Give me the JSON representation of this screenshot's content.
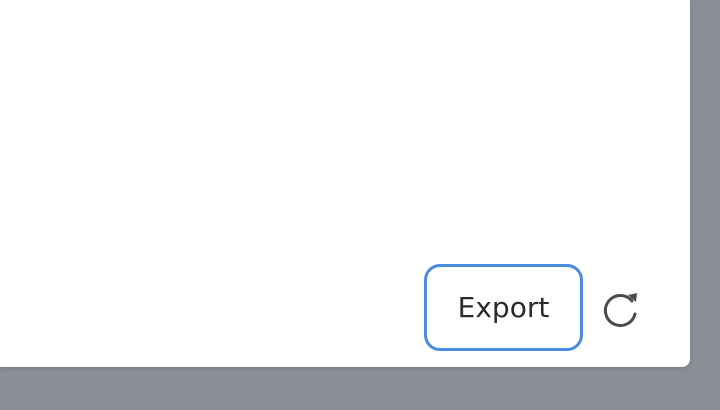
{
  "dialog": {
    "export_label": "Export",
    "refresh_icon": "refresh-icon"
  },
  "colors": {
    "backdrop": "#8b8d98",
    "panel": "#ffffff",
    "focus_ring": "#4a8ae0",
    "text": "#2b2b2b",
    "icon": "#4a4a4a"
  }
}
